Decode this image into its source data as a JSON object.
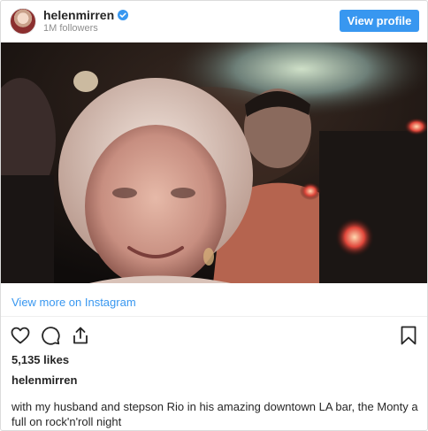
{
  "header": {
    "username": "helenmirren",
    "followers": "1M followers",
    "view_profile_label": "View profile",
    "avatar_icon": "profile-avatar",
    "verified_icon": "verified-badge-icon"
  },
  "photo": {
    "alt_subject": "selfie in a dim bar"
  },
  "link": {
    "view_more": "View more on Instagram"
  },
  "actions": {
    "icons": [
      "heart-icon",
      "comment-icon",
      "share-icon",
      "bookmark-icon"
    ]
  },
  "post": {
    "likes": "5,135 likes",
    "owner": "helenmirren",
    "caption": "with my husband and stepson Rio in his amazing downtown LA bar, the Monty a full on rock'n'roll night"
  },
  "colors": {
    "accent": "#3897f0",
    "text": "#262626",
    "muted": "#8e8e8e",
    "border": "#dbdbdb"
  }
}
